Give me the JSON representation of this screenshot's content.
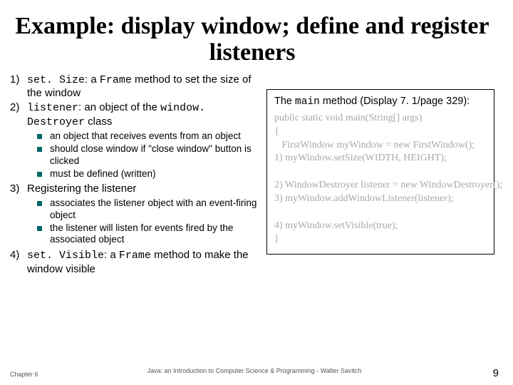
{
  "title": "Example: display window; define and register listeners",
  "items": {
    "n1": {
      "num": "1)",
      "pre": "set. Size",
      "post": ": a ",
      "mid": "Frame",
      "tail": " method to set the size of the window"
    },
    "n2": {
      "num": "2)",
      "pre": "listener",
      "post": ": an object of the ",
      "mid": "window. Destroyer",
      "tail": " class"
    },
    "sub2": {
      "a": "an object that receives events from an object",
      "b": "should close window if \"close window\" button is clicked",
      "c": "must be defined (written)"
    },
    "n3": {
      "num": "3)",
      "text": "Registering the listener"
    },
    "sub3": {
      "a": "associates the listener object with an event-firing object",
      "b": "the listener will listen for events fired by the associated object"
    },
    "n4": {
      "num": "4)",
      "pre": "set. Visible",
      "post": ": a ",
      "mid": "Frame",
      "tail": " method to make the window visible"
    }
  },
  "codebox": {
    "heading_pre": "The ",
    "heading_mono": "main",
    "heading_post": " method (Display 7. 1/page 329):",
    "code": "public static void main(String[] args)\n{\n   FirstWindow myWindow = new FirstWindow();\n1) myWindow.setSize(WIDTH, HEIGHT);\n\n2) WindowDestroyer listener = new WindowDestroyer();\n3) myWindow.addWindowListener(listener);\n\n4) myWindow.setVisible(true);\n}"
  },
  "footer": {
    "left": "Chapter 6",
    "center": "Java: an Introduction to Computer Science & Programming - Walter Savitch",
    "page": "9"
  }
}
